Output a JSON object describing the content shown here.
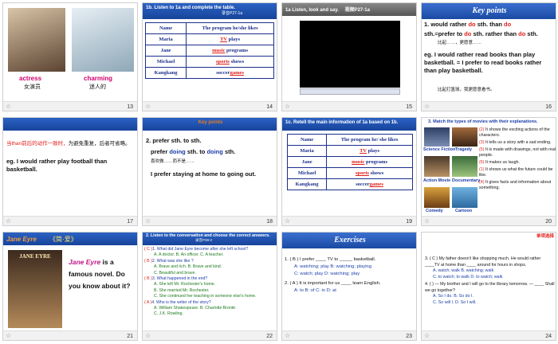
{
  "slides": [
    {
      "num": "13",
      "actress": "actress",
      "actress_cn": "女演员",
      "charming": "charming",
      "charming_cn": "迷人的"
    },
    {
      "num": "14",
      "title": "1b. Listen to 1a and complete the table.",
      "sub": "录音P27-1a",
      "col1": "Name",
      "col2": "The program he/she likes",
      "rows": [
        {
          "name": "Maria",
          "blank": "TV",
          "rest": "plays"
        },
        {
          "name": "Jane",
          "blank": "music",
          "rest": "programs"
        },
        {
          "name": "Michael",
          "blank": "sports",
          "rest": "shows"
        },
        {
          "name": "Kangkang",
          "pre": "soccer",
          "blank": "games",
          "rest": ""
        }
      ]
    },
    {
      "num": "15",
      "title": "1a Listen, look and say.",
      "video": "视频P27-1a"
    },
    {
      "num": "16",
      "title": "Key points",
      "l1a": "1. would rather ",
      "l1b": "do",
      "l1c": " sth. than ",
      "l1d": "do",
      "l2a": "sth.=prefer to ",
      "l2b": "do",
      "l2c": " sth. rather than ",
      "l2d": "do",
      "l2e": " sth.",
      "cn1": "比起……，更愿意……",
      "l3": "eg. I would rather read books than play basketball. = I prefer to read books rather than play basketball.",
      "cn2": "比起打篮球，我更愿意看书。"
    },
    {
      "num": "17",
      "l1a": "当than前后的动作一致时，",
      "l1b": "为避免重复，后者可省略。",
      "l2": "eg. I would rather play football than basketball."
    },
    {
      "num": "18",
      "title": "Key points",
      "l1": "2. prefer sth. to sth.",
      "l2a": "prefer ",
      "l2b": "doing",
      "l2c": " sth. to ",
      "l2d": "doing",
      "l2e": " sth.",
      "cn": "喜欢做……而不是……",
      "l3": "I prefer staying at home to going out."
    },
    {
      "num": "19",
      "title": "1c. Retell the main information of 1a based on 1b.",
      "col1": "Name",
      "col2": "The program he/ she likes",
      "rows": [
        {
          "name": "Maria",
          "blank": "TV",
          "rest": "plays"
        },
        {
          "name": "Jane",
          "blank": "music",
          "rest": "programs"
        },
        {
          "name": "Michael",
          "blank": "sports",
          "rest": "shows"
        },
        {
          "name": "Kangkang",
          "pre": "soccer",
          "blank": "games",
          "rest": ""
        }
      ]
    },
    {
      "num": "20",
      "title": "3. Match the types of movies with their explanations.",
      "labels": [
        "Science Fiction",
        "Tragedy",
        "Action Movie",
        "Documentary",
        "Comedy",
        "Cartoon"
      ],
      "items": [
        {
          "n": "(2)",
          "t": "It shows the exciting actions of the characters."
        },
        {
          "n": "(3)",
          "t": "It tells us a story with a sad ending."
        },
        {
          "n": "(5)",
          "t": "It is made with drawings, not with real people."
        },
        {
          "n": "(6)",
          "t": "It makes us laugh."
        },
        {
          "n": "(1)",
          "t": "It shows us what the future could be like."
        },
        {
          "n": "(4)",
          "t": "It gives facts and information about something."
        }
      ]
    },
    {
      "num": "21",
      "title": "Jane Eyre",
      "title_cn": "《简·爱》",
      "t1": "Jane Eyre",
      "t2": " is a famous novel. Do you know about it?",
      "cover": "JANE EYRE"
    },
    {
      "num": "22",
      "title": "2. Listen to the conversation and choose the correct answers.",
      "sub": "录音P28-2",
      "qs": [
        {
          "a": "( C )",
          "q": "1. What did Jane Eyre become after she left school?",
          "opts": "A. A doctor.     B. An officer.     C. A teacher."
        },
        {
          "a": "( B )",
          "q": "2. What was she like ?",
          "opts": "A. Brave and rich.   B. Brave and kind.",
          "opts2": "C. Beautiful and brave."
        },
        {
          "a": "( B )",
          "q": "3. What happened in the end?",
          "opts": "A. She left Mr. Rochester's home.",
          "opts2": "B. She married Mr. Rochester.",
          "opts3": "C. She continued her teaching in someone else's home."
        },
        {
          "a": "( A )",
          "q": "4. Who is the writer of the story?",
          "opts": "A. William Shakespeare.  B. Charlotte Brontë.",
          "opts2": "C. J.K. Rowling."
        }
      ]
    },
    {
      "num": "23",
      "title": "Exercises",
      "q1": "1. ( B ) I prefer ____ TV to _____ basketball.",
      "q1o": "A: watching; play    B: watching; playing",
      "q1o2": "C: watch; play     D: watching; play",
      "q2": "2. ( A ) It is important for us ____ learn   English.",
      "q2o": "A: to     B: of     C: in     D: at"
    },
    {
      "num": "24",
      "tag": "单项选择",
      "q3a": "3. (   C   ) My father doesn't like shopping much. He would rather ____TV at home than ____ around for hours in shops.",
      "q3o": "A. watch; walk         B. watching; walk",
      "q3o2": "C. to watch; to walk    D. to watch; walk",
      "q4a": "4. (   ) — My brother and I will go to the   library tomorrow.  — ____ Shall we go together?",
      "q4o": "A. So I do.        B. So do I.",
      "q4o2": "C. So will I.      D. So I will."
    }
  ]
}
